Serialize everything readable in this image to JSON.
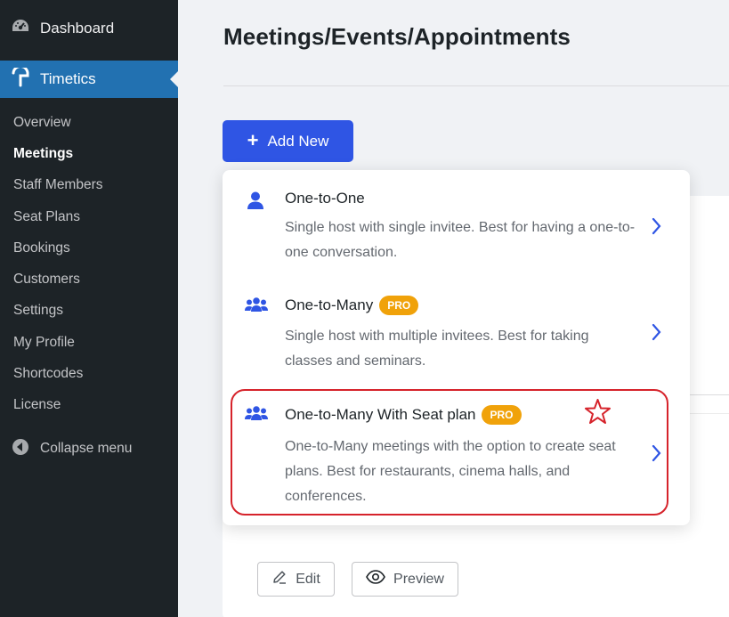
{
  "sidebar": {
    "dashboard_label": "Dashboard",
    "plugin_label": "Timetics",
    "items": [
      {
        "label": "Overview"
      },
      {
        "label": "Meetings"
      },
      {
        "label": "Staff Members"
      },
      {
        "label": "Seat Plans"
      },
      {
        "label": "Bookings"
      },
      {
        "label": "Customers"
      },
      {
        "label": "Settings"
      },
      {
        "label": "My Profile"
      },
      {
        "label": "Shortcodes"
      },
      {
        "label": "License"
      }
    ],
    "collapse_label": "Collapse menu"
  },
  "main": {
    "title": "Meetings/Events/Appointments",
    "add_new_label": "Add New",
    "edit_label": "Edit",
    "preview_label": "Preview"
  },
  "dropdown": {
    "options": [
      {
        "name": "One-to-One",
        "description": "Single host with single invitee. Best for having a one-to-one conversation.",
        "icon": "user-icon"
      },
      {
        "name": "One-to-Many",
        "badge": "PRO",
        "description": "Single host with multiple invitees. Best for taking classes and seminars.",
        "icon": "users-group-icon"
      },
      {
        "name": "One-to-Many With Seat plan",
        "badge": "PRO",
        "description": "One-to-Many meetings with the option to create seat plans. Best for restaurants, cinema halls, and conferences.",
        "icon": "users-group-icon"
      }
    ]
  },
  "colors": {
    "sidebar_bg": "#1d2327",
    "sidebar_active": "#2271b1",
    "primary_button": "#2f55e4",
    "pro_badge": "#f0a20a",
    "highlight": "#d6232b"
  }
}
